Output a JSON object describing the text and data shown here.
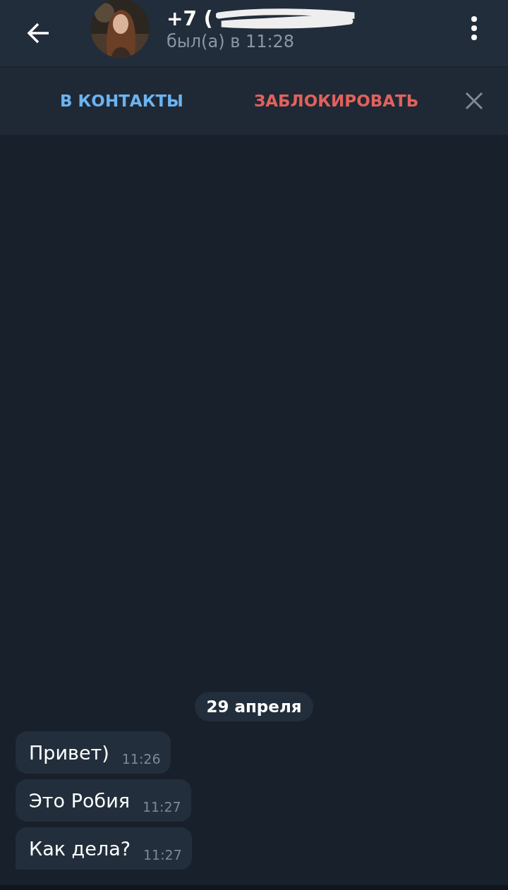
{
  "header": {
    "title": "+7 (",
    "status": "был(а) в 11:28"
  },
  "action_bar": {
    "buttons": [
      {
        "label": "В КОНТАКТЫ",
        "kind": "add"
      },
      {
        "label": "ЗАБЛОКИРОВАТЬ",
        "kind": "block"
      }
    ]
  },
  "date_label": "29 апреля",
  "messages": [
    {
      "text": "Привет)",
      "time": "11:26",
      "tail": false
    },
    {
      "text": "Это Робия",
      "time": "11:27",
      "tail": false
    },
    {
      "text": "Как дела?",
      "time": "11:27",
      "tail": true
    }
  ]
}
